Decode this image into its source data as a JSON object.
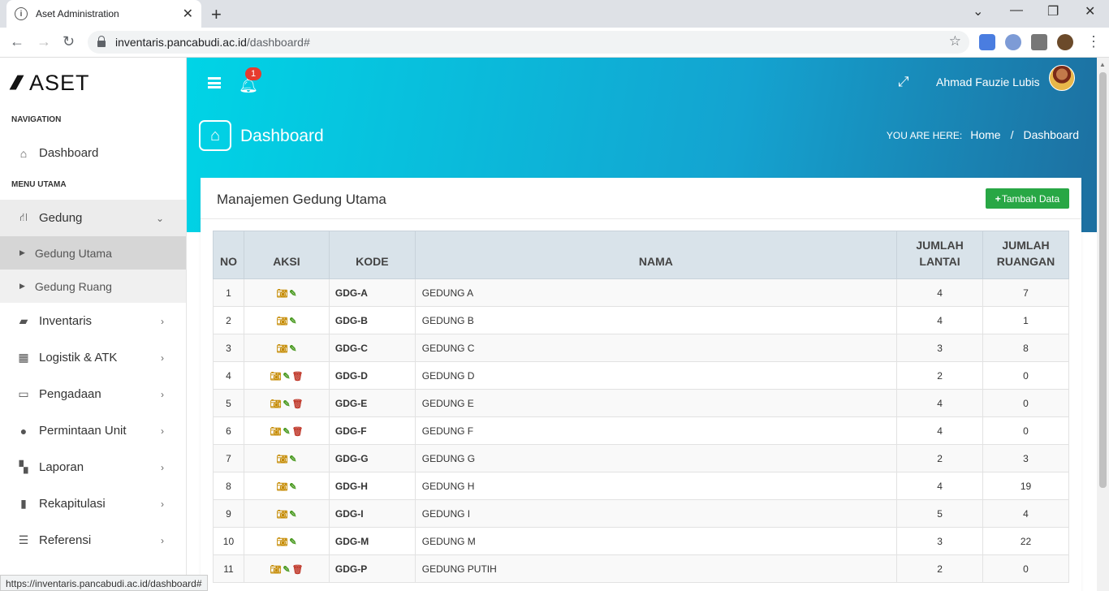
{
  "browser": {
    "tab_title": "Aset Administration",
    "tab_close": "✕",
    "new_tab": "+",
    "url_host": "inventaris.pancabudi.ac.id",
    "url_path": "/dashboard#",
    "status_url": "https://inventaris.pancabudi.ac.id/dashboard#"
  },
  "sidebar": {
    "logo_text": "ASET",
    "section_navigation": "NAVIGATION",
    "dashboard": "Dashboard",
    "section_menu": "MENU UTAMA",
    "items": [
      {
        "label": "Gedung",
        "icon": "road-icon"
      },
      {
        "label": "Inventaris",
        "icon": "briefcase-icon"
      },
      {
        "label": "Logistik & ATK",
        "icon": "table-icon"
      },
      {
        "label": "Pengadaan",
        "icon": "laptop-icon"
      },
      {
        "label": "Permintaan Unit",
        "icon": "users-icon"
      },
      {
        "label": "Laporan",
        "icon": "th-large-icon"
      },
      {
        "label": "Rekapitulasi",
        "icon": "book-icon"
      },
      {
        "label": "Referensi",
        "icon": "list-icon"
      }
    ],
    "sub_items": [
      "Gedung Utama",
      "Gedung Ruang"
    ]
  },
  "header": {
    "notification_count": "1",
    "user_name": "Ahmad Fauzie Lubis",
    "page_title": "Dashboard",
    "breadcrumb_label": "YOU ARE HERE:",
    "breadcrumb_home": "Home",
    "breadcrumb_sep": "/",
    "breadcrumb_current": "Dashboard"
  },
  "card": {
    "title": "Manajemen Gedung Utama",
    "add_button": "Tambah Data"
  },
  "table": {
    "headers": [
      "NO",
      "AKSI",
      "KODE",
      "NAMA",
      "JUMLAH LANTAI",
      "JUMLAH RUANGAN"
    ],
    "rows": [
      {
        "no": "1",
        "kode": "GDG-A",
        "nama": "GEDUNG A",
        "lantai": "4",
        "ruangan": "7",
        "deletable": false
      },
      {
        "no": "2",
        "kode": "GDG-B",
        "nama": "GEDUNG B",
        "lantai": "4",
        "ruangan": "1",
        "deletable": false
      },
      {
        "no": "3",
        "kode": "GDG-C",
        "nama": "GEDUNG C",
        "lantai": "3",
        "ruangan": "8",
        "deletable": false
      },
      {
        "no": "4",
        "kode": "GDG-D",
        "nama": "GEDUNG D",
        "lantai": "2",
        "ruangan": "0",
        "deletable": true
      },
      {
        "no": "5",
        "kode": "GDG-E",
        "nama": "GEDUNG E",
        "lantai": "4",
        "ruangan": "0",
        "deletable": true
      },
      {
        "no": "6",
        "kode": "GDG-F",
        "nama": "GEDUNG F",
        "lantai": "4",
        "ruangan": "0",
        "deletable": true
      },
      {
        "no": "7",
        "kode": "GDG-G",
        "nama": "GEDUNG G",
        "lantai": "2",
        "ruangan": "3",
        "deletable": false
      },
      {
        "no": "8",
        "kode": "GDG-H",
        "nama": "GEDUNG H",
        "lantai": "4",
        "ruangan": "19",
        "deletable": false
      },
      {
        "no": "9",
        "kode": "GDG-I",
        "nama": "GEDUNG I",
        "lantai": "5",
        "ruangan": "4",
        "deletable": false
      },
      {
        "no": "10",
        "kode": "GDG-M",
        "nama": "GEDUNG M",
        "lantai": "3",
        "ruangan": "22",
        "deletable": false
      },
      {
        "no": "11",
        "kode": "GDG-P",
        "nama": "GEDUNG PUTIH",
        "lantai": "2",
        "ruangan": "0",
        "deletable": true
      }
    ]
  },
  "colors": {
    "hero_start": "#00d4e6",
    "hero_end": "#1d6fa0",
    "add_button": "#28a745",
    "badge": "#e63b2e",
    "table_header": "#d9e3ea"
  }
}
